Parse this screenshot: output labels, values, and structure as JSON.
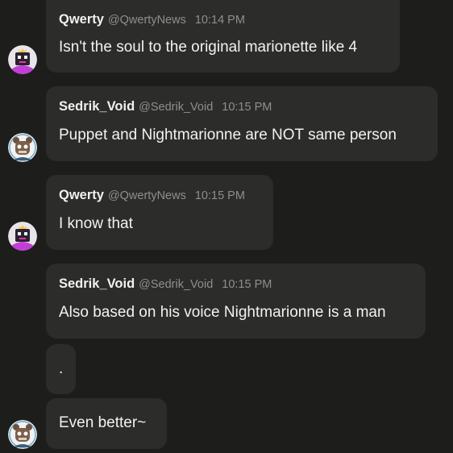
{
  "messages": [
    {
      "user": "Qwerty",
      "handle": "@QwertyNews",
      "time": "10:14 PM",
      "text": "Isn't the soul to the original marionette like 4",
      "avatar": "purple-puppet-avatar-icon"
    },
    {
      "user": "Sedrik_Void",
      "handle": "@Sedrik_Void",
      "time": "10:15 PM",
      "text": "Puppet and Nightmarionne are NOT same person",
      "avatar": "white-bear-avatar-icon"
    },
    {
      "user": "Qwerty",
      "handle": "@QwertyNews",
      "time": "10:15 PM",
      "text": "I know that",
      "avatar": "purple-puppet-avatar-icon"
    },
    {
      "user": "Sedrik_Void",
      "handle": "@Sedrik_Void",
      "time": "10:15 PM",
      "text": "Also based on his voice Nightmarionne is a man"
    },
    {
      "text": "."
    },
    {
      "text": "Even better~",
      "avatar": "white-bear-avatar-icon"
    }
  ],
  "colors": {
    "background": "#1d1e1c",
    "bubble": "#2c2d2b",
    "text": "#f2f2f2",
    "muted": "#8e8f8c"
  }
}
